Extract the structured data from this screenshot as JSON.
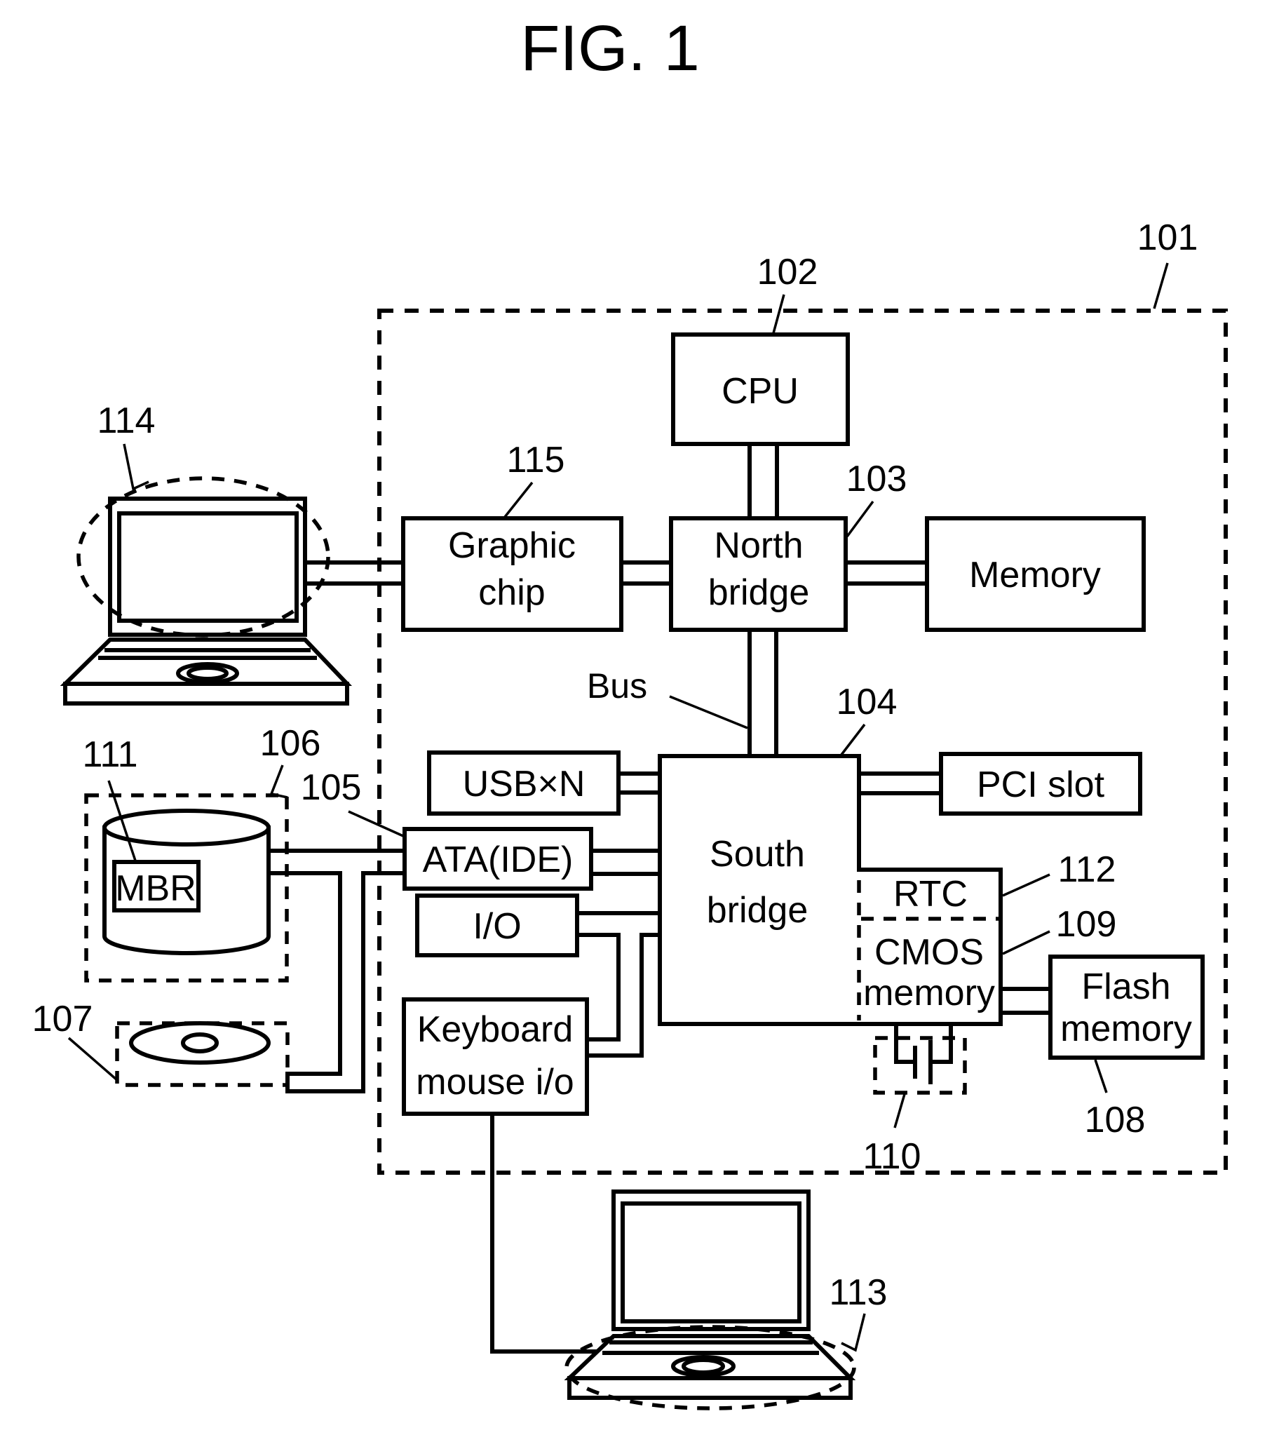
{
  "title": "FIG. 1",
  "reference_numerals": {
    "computer": "101",
    "cpu": "102",
    "north_bridge": "103",
    "south_bridge": "104",
    "ata": "105",
    "hard_disk": "106",
    "optical_drive": "107",
    "flash_memory": "108",
    "cmos_memory": "109",
    "battery": "110",
    "mbr": "111",
    "rtc": "112",
    "input_terminal": "113",
    "display": "114",
    "graphic_chip": "115"
  },
  "blocks": {
    "cpu": "CPU",
    "north_bridge": [
      "North",
      "bridge"
    ],
    "graphic_chip": [
      "Graphic",
      "chip"
    ],
    "memory": "Memory",
    "south_bridge": [
      "South",
      "bridge"
    ],
    "usb": "USB×N",
    "pci": "PCI slot",
    "ata": "ATA(IDE)",
    "io": "I/O",
    "keyboard": [
      "Keyboard",
      "mouse i/o"
    ],
    "rtc": "RTC",
    "cmos": [
      "CMOS",
      "memory"
    ],
    "flash": [
      "Flash",
      "memory"
    ],
    "mbr": "MBR"
  },
  "annotations": {
    "bus": "Bus"
  }
}
